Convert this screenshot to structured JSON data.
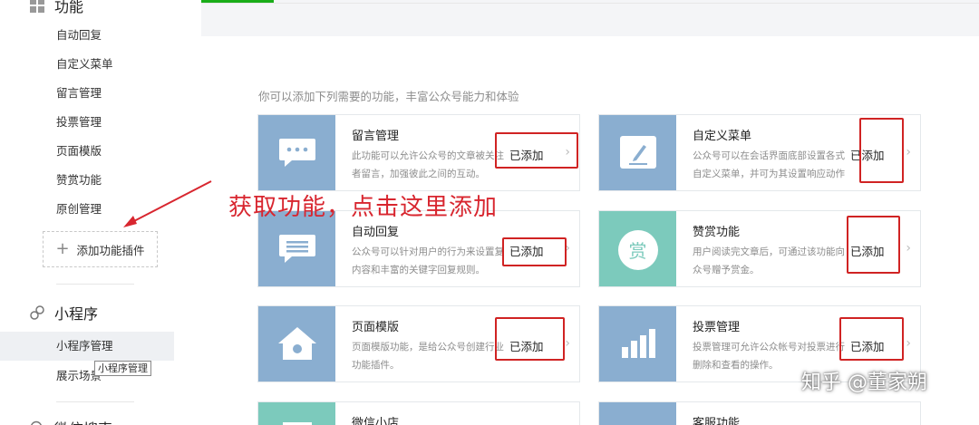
{
  "sidebar": {
    "functions_title": "功能",
    "functions_items": [
      "自动回复",
      "自定义菜单",
      "留言管理",
      "投票管理",
      "页面模版",
      "赞赏功能",
      "原创管理"
    ],
    "add_plugin_label": "添加功能插件",
    "miniprogram_title": "小程序",
    "miniprogram_items": [
      "小程序管理",
      "展示场景"
    ],
    "tooltip": "小程序管理",
    "next_section_title": "微信搜索"
  },
  "main": {
    "intro": "你可以添加下列需要的功能，丰富公众号能力和体验",
    "cards": [
      {
        "title": "留言管理",
        "desc": "此功能可以允许公众号的文章被关注者留言，加强彼此之间的互动。",
        "status": "已添加",
        "icon": "speech-bubble-icon",
        "color": "#8aaed0"
      },
      {
        "title": "自定义菜单",
        "desc": "公众号可以在会话界面底部设置各式自定义菜单，并可为其设置响应动作",
        "status": "已添加",
        "icon": "pencil-icon",
        "color": "#8aaed0"
      },
      {
        "title": "自动回复",
        "desc": "公众号可以针对用户的行为来设置复内容和丰富的关键字回复规则。",
        "status": "已添加",
        "icon": "message-list-icon",
        "color": "#8aaed0"
      },
      {
        "title": "赞赏功能",
        "desc": "用户阅读完文章后，可通过该功能向众号赠予赏金。",
        "status": "已添加",
        "icon": "reward-icon",
        "color": "#7ccabc",
        "icon_char": "赏"
      },
      {
        "title": "页面模版",
        "desc": "页面模版功能，是给公众号创建行业功能插件。",
        "status": "已添加",
        "icon": "home-icon",
        "color": "#8aaed0"
      },
      {
        "title": "投票管理",
        "desc": "投票管理可允许公众帐号对投票进行删除和查看的操作。",
        "status": "已添加",
        "icon": "bar-chart-icon",
        "color": "#8aaed0"
      },
      {
        "title": "微信小店",
        "desc": "",
        "status": "",
        "icon": "store-icon",
        "color": "#7ccabc"
      },
      {
        "title": "客服功能",
        "desc": "",
        "status": "",
        "icon": "service-icon",
        "color": "#8aaed0"
      }
    ]
  },
  "annotation": {
    "text": "获取功能，点击这里添加",
    "color": "#d8262f"
  },
  "watermark": "知乎 @董家朔"
}
